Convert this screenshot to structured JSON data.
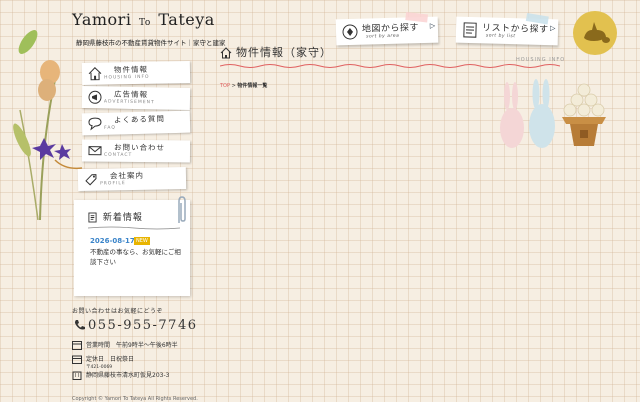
{
  "site": {
    "title_part1": "Yamori",
    "title_small": "To",
    "title_part2": "Tateya",
    "description": "静岡県藤枝市の不動産賃貸物件サイト｜家守と建家"
  },
  "nav": [
    {
      "label": "物件情報",
      "sub": "HOUSING INFO",
      "icon": "house-icon"
    },
    {
      "label": "広告情報",
      "sub": "ADVERTISEMENT",
      "icon": "megaphone-icon"
    },
    {
      "label": "よくある質問",
      "sub": "FAQ",
      "icon": "speech-bubble-icon"
    },
    {
      "label": "お問い合わせ",
      "sub": "CONTACT",
      "icon": "mail-icon"
    },
    {
      "label": "会社案内",
      "sub": "PROFILE",
      "icon": "tag-icon"
    }
  ],
  "news": {
    "title": "新着情報",
    "items": [
      {
        "date": "2026-08-17",
        "badge": "NEW",
        "text": "不動産の事なら、お気軽にご相談下さい"
      }
    ]
  },
  "contact": {
    "lead": "お問い合わせはお気軽にどうぞ",
    "phone": "055-955-7746",
    "hours": "営業時間　午前9時半～午後6時半",
    "closed": "定休日　日祝祭日",
    "zip": "〒421-0069",
    "address": "静岡県藤枝市清水町仮見203-3"
  },
  "copyright": "Copyright © Yamori To Tateya All Rights Reserved.",
  "search_tabs": [
    {
      "label": "地図から探す",
      "sub": "sort by area",
      "icon": "map-icon"
    },
    {
      "label": "リストから探す",
      "sub": "sort by list",
      "icon": "list-icon"
    }
  ],
  "page": {
    "title": "物件情報（家守）",
    "title_en": "HOUSING INFO"
  },
  "breadcrumb": {
    "home": "TOP",
    "separator": ">",
    "current": "物件情報一覧"
  },
  "colors": {
    "accent_red": "#e06060",
    "news_date_blue": "#3a84c9",
    "badge_yellow": "#e8b400",
    "background": "#f6eee2"
  }
}
